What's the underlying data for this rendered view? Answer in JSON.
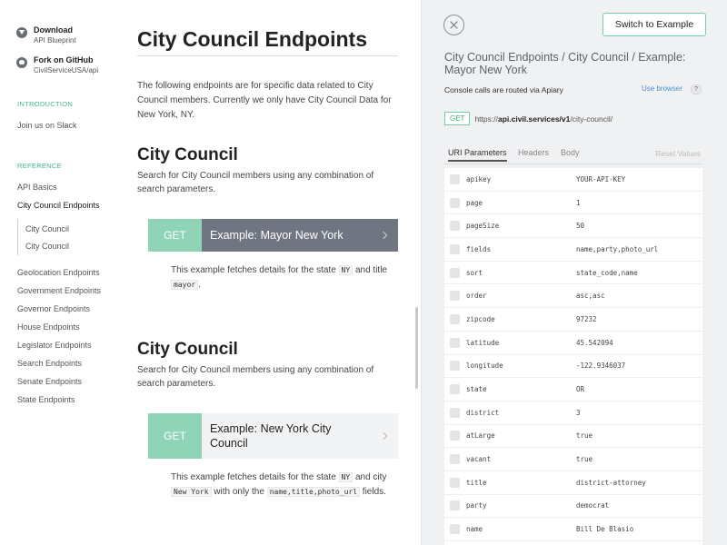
{
  "sidebar": {
    "download": {
      "title": "Download",
      "sub": "API Blueprint"
    },
    "github": {
      "title": "Fork on GitHub",
      "sub": "CivilServiceUSA/api"
    },
    "introduction_heading": "INTRODUCTION",
    "slack": "Join us on Slack",
    "reference_heading": "REFERENCE",
    "links": [
      "API Basics",
      "City Council Endpoints",
      "Geolocation Endpoints",
      "Government Endpoints",
      "Governor Endpoints",
      "House Endpoints",
      "Legislator Endpoints",
      "Search Endpoints",
      "Senate Endpoints",
      "State Endpoints"
    ],
    "sublinks": [
      "City Council",
      "City Council"
    ]
  },
  "main": {
    "title": "City Council Endpoints",
    "intro": "The following endpoints are for specific data related to City Council members. Currently we only have City Council Data for New York, NY.",
    "sections": [
      {
        "heading": "City Council",
        "desc": "Search for City Council members using any combination of search parameters.",
        "verb": "GET",
        "example_title": "Example: Mayor New York",
        "text_a": "This example fetches details for the state ",
        "code_a": "NY",
        "text_b": " and title ",
        "code_b": "mayor",
        "text_c": "."
      },
      {
        "heading": "City Council",
        "desc": "Search for City Council members using any combination of search parameters.",
        "verb": "GET",
        "example_title": "Example: New York City Council",
        "text_a": "This example fetches details for the state ",
        "code_a": "NY",
        "text_b": " and city ",
        "code_b": "New York",
        "text_c": " with only the ",
        "code_c": "name,title,photo_url",
        "text_d": " fields."
      }
    ]
  },
  "console": {
    "switch_label": "Switch to Example",
    "breadcrumb": "City Council Endpoints  /  City Council  /  Example: Mayor New York",
    "routed": "Console calls are routed via Apiary",
    "use_browser": "Use browser",
    "help": "?",
    "method": "GET",
    "url_prefix": "https://",
    "url_host": "api.civil.services/v1",
    "url_path": "/city-council/",
    "tabs": [
      "URI Parameters",
      "Headers",
      "Body"
    ],
    "reset": "Reset Values",
    "params": [
      {
        "name": "apikey",
        "value": "YOUR-API-KEY"
      },
      {
        "name": "page",
        "value": "1"
      },
      {
        "name": "pageSize",
        "value": "50"
      },
      {
        "name": "fields",
        "value": "name,party,photo_url"
      },
      {
        "name": "sort",
        "value": "state_code,name"
      },
      {
        "name": "order",
        "value": "asc,asc"
      },
      {
        "name": "zipcode",
        "value": "97232"
      },
      {
        "name": "latitude",
        "value": "45.542094"
      },
      {
        "name": "longitude",
        "value": "-122.9346037"
      },
      {
        "name": "state",
        "value": "OR"
      },
      {
        "name": "district",
        "value": "3"
      },
      {
        "name": "atLarge",
        "value": "true"
      },
      {
        "name": "vacant",
        "value": "true"
      },
      {
        "name": "title",
        "value": "district-attorney"
      },
      {
        "name": "party",
        "value": "democrat"
      },
      {
        "name": "name",
        "value": "Bill De Blasio"
      },
      {
        "name": "",
        "value": ""
      }
    ]
  },
  "colors": {
    "accent_green": "#8fd4b6",
    "active_example": "#6f7681"
  }
}
